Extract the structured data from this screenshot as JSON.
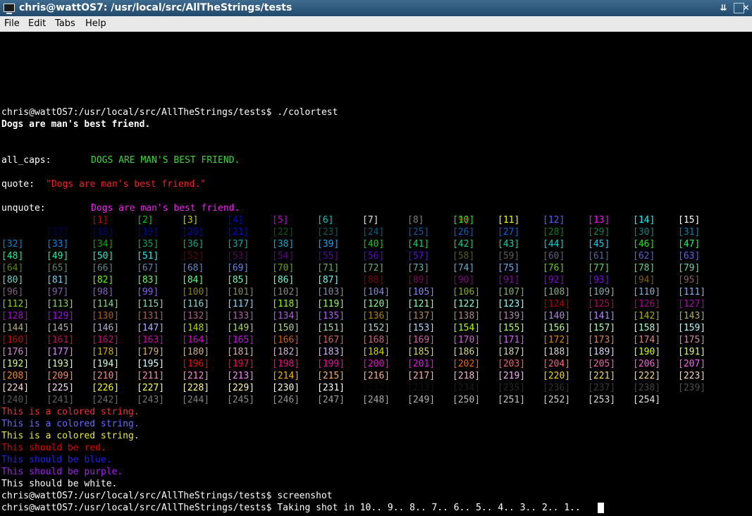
{
  "window": {
    "title": "chris@wattOS7: /usr/local/src/AllTheStrings/tests",
    "buttons": [
      "⇊",
      "□",
      "✕"
    ]
  },
  "menu": [
    "File",
    "Edit",
    "Tabs",
    "Help"
  ],
  "terminal": {
    "prompt1": "chris@wattOS7:/usr/local/src/AllTheStrings/tests$ ./colortest",
    "dogs": "Dogs are man's best friend.",
    "allcaps_label": "all_caps:",
    "allcaps_value": "DOGS ARE MAN'S BEST FRIEND.",
    "quote_label": "quote:",
    "quote_value": "\"Dogs are man's best friend.\"",
    "unquote_label": "unquote:",
    "unquote_value": "Dogs are man's best friend.",
    "colored_strings": [
      {
        "text": "This is a colored string.",
        "color": "#ee3333"
      },
      {
        "text": "This is a colored string.",
        "color": "#6a6aff"
      },
      {
        "text": "This is a colored string.",
        "color": "#e8e84a"
      },
      {
        "text": "This should be red.",
        "color": "#dd0000"
      },
      {
        "text": "This should be blue.",
        "color": "#2222ee"
      },
      {
        "text": "This should be purple.",
        "color": "#a020f0"
      },
      {
        "text": "This should be white.",
        "color": "#ffffff"
      }
    ],
    "prompt2": "chris@wattOS7:/usr/local/src/AllTheStrings/tests$ screenshot",
    "prompt3": "chris@wattOS7:/usr/local/src/AllTheStrings/tests$ Taking shot in 10.. 9.. 8.. 7.. 6.. 5.. 4.. 3.. 2.. 1.. "
  },
  "colors256": [
    "#000000",
    "#cd0000",
    "#00cd00",
    "#cdcd00",
    "#0000ee",
    "#cd00cd",
    "#00cdcd",
    "#e5e5e5",
    "#7f7f7f",
    "#ff0000",
    "#00ff00",
    "#ffff00",
    "#5c5cff",
    "#ff00ff",
    "#00ffff",
    "#ffffff"
  ]
}
